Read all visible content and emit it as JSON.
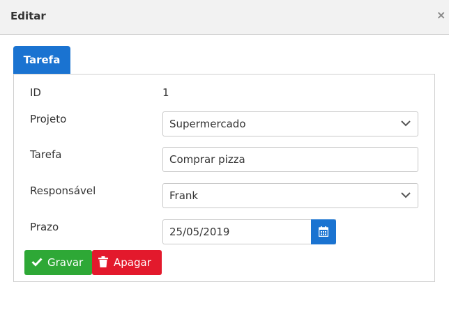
{
  "dialog": {
    "title": "Editar",
    "close_symbol": "×"
  },
  "tabs": [
    {
      "label": "Tarefa",
      "active": true
    }
  ],
  "form": {
    "id": {
      "label": "ID",
      "value": "1"
    },
    "projeto": {
      "label": "Projeto",
      "value": "Supermercado"
    },
    "tarefa": {
      "label": "Tarefa",
      "value": "Comprar pizza"
    },
    "responsavel": {
      "label": "Responsável",
      "value": "Frank"
    },
    "prazo": {
      "label": "Prazo",
      "value": "25/05/2019"
    }
  },
  "buttons": {
    "save": {
      "label": "Gravar",
      "icon": "check-icon"
    },
    "delete": {
      "label": "Apagar",
      "icon": "trash-icon"
    }
  },
  "colors": {
    "primary": "#1a73d1",
    "success": "#2ea836",
    "danger": "#e3192c"
  }
}
